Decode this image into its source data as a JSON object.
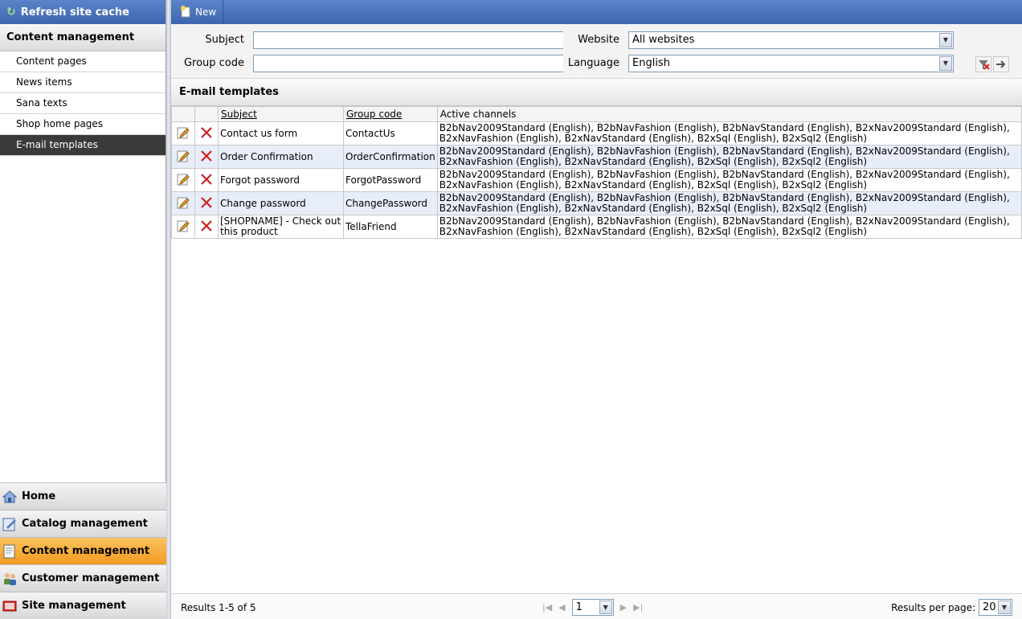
{
  "sidebar": {
    "refresh_label": "Refresh site cache",
    "section_title": "Content management",
    "items": [
      {
        "label": "Content pages"
      },
      {
        "label": "News items"
      },
      {
        "label": "Sana texts"
      },
      {
        "label": "Shop home pages"
      },
      {
        "label": "E-mail templates"
      }
    ],
    "active_item": "E-mail templates",
    "bottom_nav": [
      {
        "label": "Home",
        "icon": "house-icon"
      },
      {
        "label": "Catalog management",
        "icon": "catalog-icon"
      },
      {
        "label": "Content management",
        "icon": "content-icon"
      },
      {
        "label": "Customer management",
        "icon": "customers-icon"
      },
      {
        "label": "Site management",
        "icon": "site-icon"
      }
    ],
    "active_nav": "Content management"
  },
  "toolbar": {
    "new_label": "New"
  },
  "filter": {
    "subject_label": "Subject",
    "subject_value": "",
    "group_code_label": "Group code",
    "group_code_value": "",
    "website_label": "Website",
    "website_value": "All websites",
    "language_label": "Language",
    "language_value": "English"
  },
  "grid": {
    "title": "E-mail templates",
    "columns": {
      "subject": "Subject",
      "group_code": "Group code",
      "active_channels": "Active channels"
    },
    "rows": [
      {
        "subject": "Contact us form",
        "group_code": "ContactUs",
        "channels_line1": "B2bNav2009Standard (English), B2bNavFashion (English), B2bNavStandard (English), B2xNav2009Standard (English),",
        "channels_line2": "B2xNavFashion (English), B2xNavStandard (English), B2xSql (English), B2xSql2 (English)"
      },
      {
        "subject": "Order Confirmation",
        "group_code": "OrderConfirmation",
        "channels_line1": "B2bNav2009Standard (English), B2bNavFashion (English), B2bNavStandard (English), B2xNav2009Standard (English),",
        "channels_line2": "B2xNavFashion (English), B2xNavStandard (English), B2xSql (English), B2xSql2 (English)"
      },
      {
        "subject": "Forgot password",
        "group_code": "ForgotPassword",
        "channels_line1": "B2bNav2009Standard (English), B2bNavFashion (English), B2bNavStandard (English), B2xNav2009Standard (English),",
        "channels_line2": "B2xNavFashion (English), B2xNavStandard (English), B2xSql (English), B2xSql2 (English)"
      },
      {
        "subject": "Change password",
        "group_code": "ChangePassword",
        "channels_line1": "B2bNav2009Standard (English), B2bNavFashion (English), B2bNavStandard (English), B2xNav2009Standard (English),",
        "channels_line2": "B2xNavFashion (English), B2xNavStandard (English), B2xSql (English), B2xSql2 (English)"
      },
      {
        "subject": "[SHOPNAME] - Check out this product",
        "group_code": "TellaFriend",
        "channels_line1": "B2bNav2009Standard (English), B2bNavFashion (English), B2bNavStandard (English), B2xNav2009Standard (English),",
        "channels_line2": "B2xNavFashion (English), B2xNavStandard (English), B2xSql (English), B2xSql2 (English)"
      }
    ]
  },
  "footer": {
    "results_text": "Results 1-5 of 5",
    "page_value": "1",
    "rpp_label": "Results per page:",
    "rpp_value": "20"
  },
  "colors": {
    "toolbar_blue": "#3d66b0",
    "active_nav_orange": "#f39a1f",
    "active_item_dark": "#3a3a3a",
    "alt_row": "#e8eef9"
  }
}
